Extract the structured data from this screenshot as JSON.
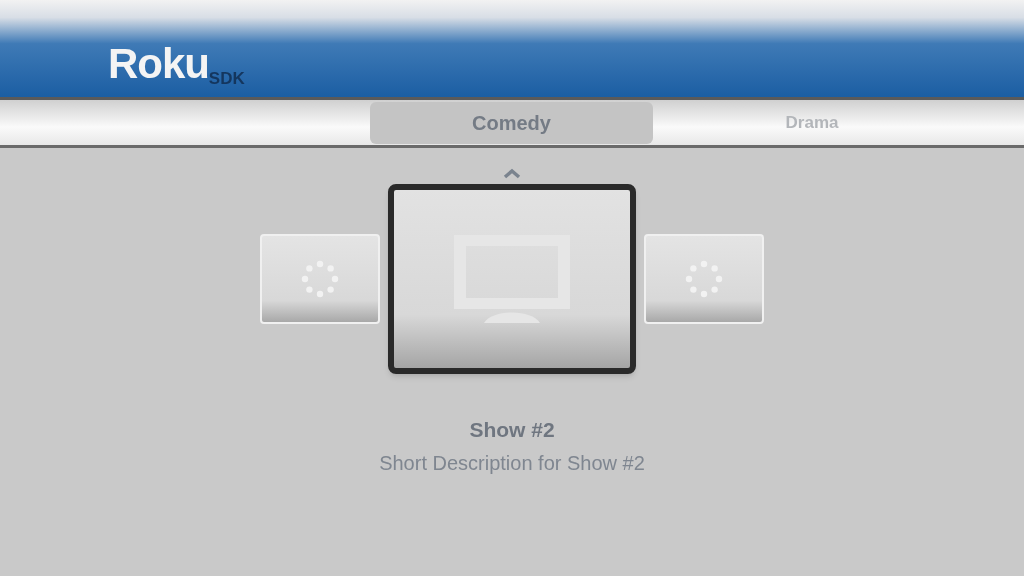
{
  "logo": {
    "brand": "Roku",
    "suffix": "SDK"
  },
  "tabs": [
    {
      "label": "Comedy",
      "selected": true
    },
    {
      "label": "Drama",
      "selected": false
    }
  ],
  "posters": [
    {
      "selected": false
    },
    {
      "selected": true
    },
    {
      "selected": false
    }
  ],
  "details": {
    "title": "Show #2",
    "description": "Short Description for Show #2"
  }
}
